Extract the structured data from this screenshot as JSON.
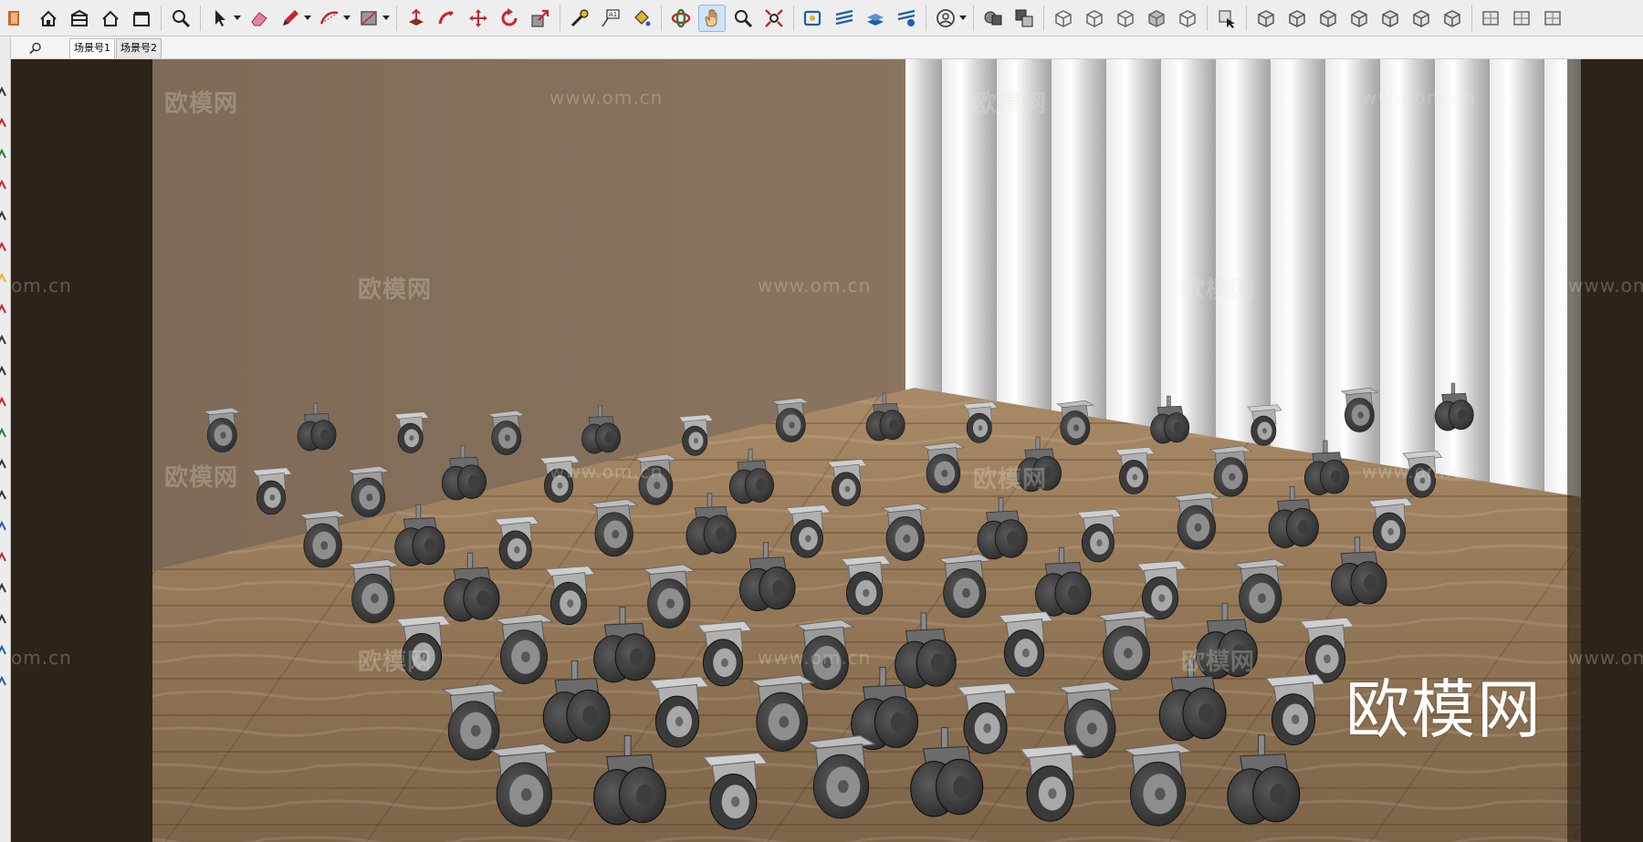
{
  "toolbar": {
    "groups": [
      [
        "sketchup-icon",
        "home-icon",
        "warehouse-icon",
        "house-icon",
        "extension-warehouse-icon"
      ],
      [
        "zoom-extents-icon"
      ],
      [
        "select-icon",
        "eraser-icon",
        "pencil-icon",
        "arc-icon",
        "rectangle-icon"
      ],
      [
        "push-pull-icon",
        "follow-me-icon",
        "move-icon",
        "rotate-icon",
        "scale-icon"
      ],
      [
        "tape-measure-icon",
        "text-icon",
        "paint-bucket-icon"
      ],
      [
        "orbit-icon",
        "pan-icon",
        "zoom-icon",
        "zoom-window-icon"
      ],
      [
        "section-plane-icon",
        "display-section-icon",
        "section-fill-icon",
        "section-cuts-icon"
      ],
      [
        "profile-icon"
      ],
      [
        "solid-union-icon",
        "solid-subtract-icon"
      ],
      [
        "xray-icon",
        "wireframe-icon",
        "hidden-line-icon",
        "shaded-icon",
        "monochrome-icon"
      ],
      [
        "component-select-icon"
      ],
      [
        "sandbox-icon",
        "from-contours-icon",
        "from-scratch-icon",
        "smoove-icon",
        "stamp-icon",
        "drape-icon",
        "flip-edge-icon"
      ],
      [
        "iso-view-icon",
        "top-view-icon",
        "front-view-icon"
      ]
    ],
    "active": "pan-icon"
  },
  "scenes": {
    "search_icon": "search-icon",
    "tabs": [
      "场景号1",
      "场景号2"
    ],
    "active_index": 0
  },
  "viewport": {
    "watermarks": [
      "欧模网",
      "www.om.cn",
      "欧模网",
      "www.om.cn",
      "欧模网",
      "www.om.cn",
      "欧模网",
      "om.cn",
      "www.om.",
      "欧模网",
      "www.om.cn",
      "欧模网",
      "www.om.cn",
      "欧模网",
      "www.om.cn",
      "欧模网",
      "om.cn",
      "www.om."
    ],
    "brand_logo": "欧模网"
  }
}
